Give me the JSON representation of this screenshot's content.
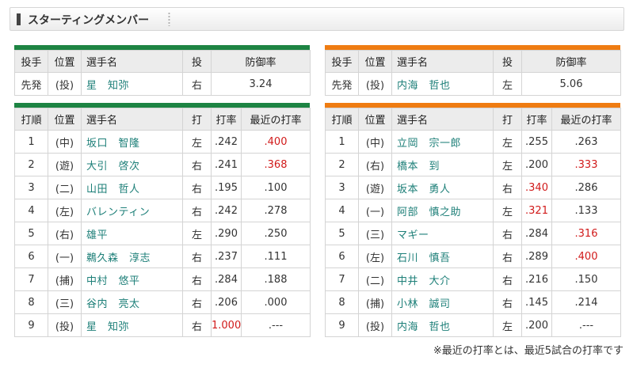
{
  "header": {
    "title": "スターティングメンバー"
  },
  "pitcher_columns": [
    "投手",
    "位置",
    "選手名",
    "投",
    "防御率"
  ],
  "lineup_columns": [
    "打順",
    "位置",
    "選手名",
    "打",
    "打率",
    "最近の打率"
  ],
  "colors": {
    "left_team": "#1d8443",
    "right_team": "#ef7c12",
    "name_link": "#1d7f78",
    "highlight": "#d11a1a"
  },
  "left": {
    "pitcher": {
      "role": "先発",
      "pos": "(投)",
      "name": "星　知弥",
      "throws": "右",
      "era": "3.24"
    },
    "lineup": [
      {
        "order": "1",
        "pos": "(中)",
        "name": "坂口　智隆",
        "bats": "左",
        "avg": ".242",
        "recent": ".400",
        "recent_hi": true
      },
      {
        "order": "2",
        "pos": "(遊)",
        "name": "大引　啓次",
        "bats": "右",
        "avg": ".241",
        "recent": ".368",
        "recent_hi": true
      },
      {
        "order": "3",
        "pos": "(二)",
        "name": "山田　哲人",
        "bats": "右",
        "avg": ".195",
        "recent": ".100"
      },
      {
        "order": "4",
        "pos": "(左)",
        "name": "バレンティン",
        "bats": "右",
        "avg": ".242",
        "recent": ".278"
      },
      {
        "order": "5",
        "pos": "(右)",
        "name": "雄平",
        "bats": "左",
        "avg": ".290",
        "recent": ".250"
      },
      {
        "order": "6",
        "pos": "(一)",
        "name": "鵜久森　淳志",
        "bats": "右",
        "avg": ".237",
        "recent": ".111"
      },
      {
        "order": "7",
        "pos": "(捕)",
        "name": "中村　悠平",
        "bats": "右",
        "avg": ".284",
        "recent": ".188"
      },
      {
        "order": "8",
        "pos": "(三)",
        "name": "谷内　亮太",
        "bats": "右",
        "avg": ".206",
        "recent": ".000"
      },
      {
        "order": "9",
        "pos": "(投)",
        "name": "星　知弥",
        "bats": "右",
        "avg": "1.000",
        "avg_hi": true,
        "recent": ".---"
      }
    ]
  },
  "right": {
    "pitcher": {
      "role": "先発",
      "pos": "(投)",
      "name": "内海　哲也",
      "throws": "左",
      "era": "5.06"
    },
    "lineup": [
      {
        "order": "1",
        "pos": "(中)",
        "name": "立岡　宗一郎",
        "bats": "左",
        "avg": ".255",
        "recent": ".263"
      },
      {
        "order": "2",
        "pos": "(右)",
        "name": "橋本　到",
        "bats": "左",
        "avg": ".200",
        "recent": ".333",
        "recent_hi": true
      },
      {
        "order": "3",
        "pos": "(遊)",
        "name": "坂本　勇人",
        "bats": "右",
        "avg": ".340",
        "avg_hi": true,
        "recent": ".286"
      },
      {
        "order": "4",
        "pos": "(一)",
        "name": "阿部　慎之助",
        "bats": "左",
        "avg": ".321",
        "avg_hi": true,
        "recent": ".133"
      },
      {
        "order": "5",
        "pos": "(三)",
        "name": "マギー",
        "bats": "右",
        "avg": ".284",
        "recent": ".316",
        "recent_hi": true
      },
      {
        "order": "6",
        "pos": "(左)",
        "name": "石川　慎吾",
        "bats": "右",
        "avg": ".289",
        "recent": ".400",
        "recent_hi": true
      },
      {
        "order": "7",
        "pos": "(二)",
        "name": "中井　大介",
        "bats": "右",
        "avg": ".216",
        "recent": ".150"
      },
      {
        "order": "8",
        "pos": "(捕)",
        "name": "小林　誠司",
        "bats": "右",
        "avg": ".145",
        "recent": ".214"
      },
      {
        "order": "9",
        "pos": "(投)",
        "name": "内海　哲也",
        "bats": "左",
        "avg": ".200",
        "recent": ".---"
      }
    ]
  },
  "footnote": "※最近の打率とは、最近5試合の打率です"
}
